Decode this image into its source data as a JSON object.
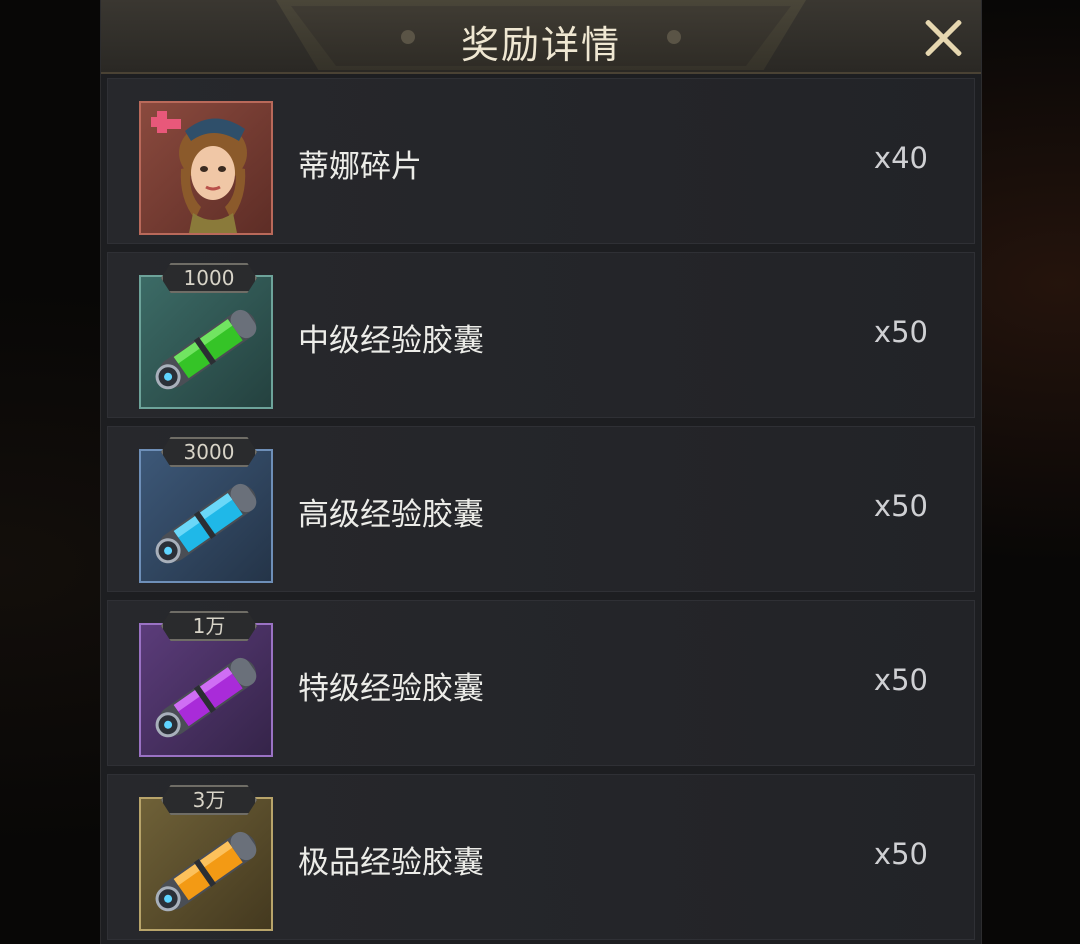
{
  "dialog": {
    "title": "奖励详情",
    "close_icon": "close-icon"
  },
  "rewards": [
    {
      "name": "蒂娜碎片",
      "quantity": "x40",
      "badge": "",
      "icon": "character-fragment-portrait-icon",
      "color": "#b9695a"
    },
    {
      "name": "中级经验胶囊",
      "quantity": "x50",
      "badge": "1000",
      "icon": "green-exp-capsule-icon",
      "color": "#35c427"
    },
    {
      "name": "高级经验胶囊",
      "quantity": "x50",
      "badge": "3000",
      "icon": "blue-exp-capsule-icon",
      "color": "#1fb8e8"
    },
    {
      "name": "特级经验胶囊",
      "quantity": "x50",
      "badge": "1万",
      "icon": "purple-exp-capsule-icon",
      "color": "#a92bd9"
    },
    {
      "name": "极品经验胶囊",
      "quantity": "x50",
      "badge": "3万",
      "icon": "orange-exp-capsule-icon",
      "color": "#f39a14"
    }
  ]
}
